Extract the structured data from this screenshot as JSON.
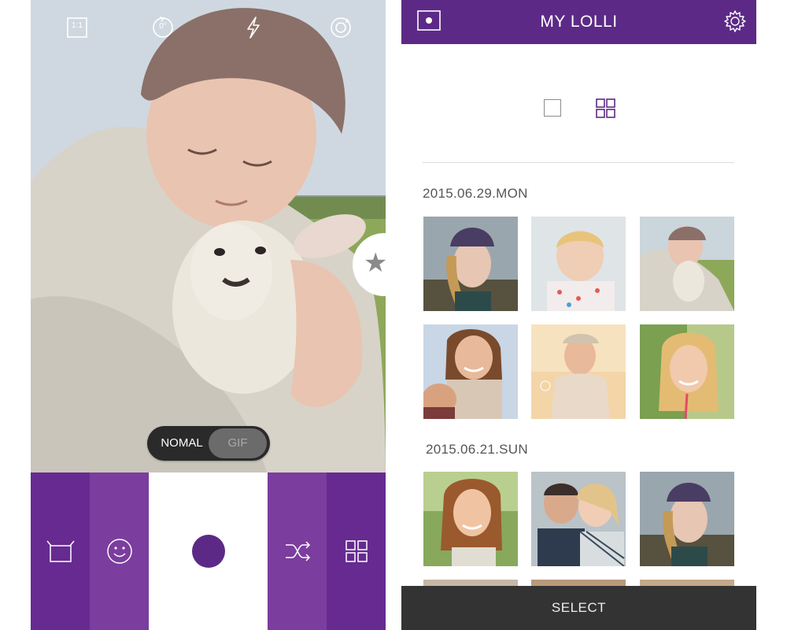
{
  "camera": {
    "top_icons": [
      {
        "name": "aspect-ratio-icon",
        "label": "1:1"
      },
      {
        "name": "rotation-icon",
        "label": "0°"
      },
      {
        "name": "flash-icon"
      },
      {
        "name": "switch-camera-icon"
      }
    ],
    "mode_toggle": {
      "options": [
        "NOMAL",
        "GIF"
      ],
      "selected": "NOMAL"
    },
    "star_tab_icon": "star-icon",
    "bottom_bar": [
      {
        "name": "frame-icon",
        "color": "#662a90"
      },
      {
        "name": "smiley-icon",
        "color": "#7b3d9e"
      },
      {
        "name": "shutter",
        "color": "#ffffff"
      },
      {
        "name": "shuffle-icon",
        "color": "#7b3d9e"
      },
      {
        "name": "gallery-grid-icon",
        "color": "#662a90"
      }
    ],
    "accent": "#5c2a86"
  },
  "gallery": {
    "title": "MY LOLLI",
    "header_color": "#5c2a86",
    "left_icon": "record-icon",
    "right_icon": "settings-gear-icon",
    "view_modes": [
      "single-view-icon",
      "grid-view-icon"
    ],
    "sections": [
      {
        "date": "2015.06.29.MON",
        "photos": [
          "girl in knit hat",
          "toddler in polka-dot top",
          "person hugging lamb",
          "smiling woman with child",
          "woman with headband in sunlight",
          "smiling girl with straw"
        ]
      },
      {
        "date": "2015.06.21.SUN",
        "photos": [
          "smiling young woman outdoors",
          "couple laughing together",
          "girl in knit hat"
        ]
      }
    ],
    "select_label": "SELECT"
  }
}
